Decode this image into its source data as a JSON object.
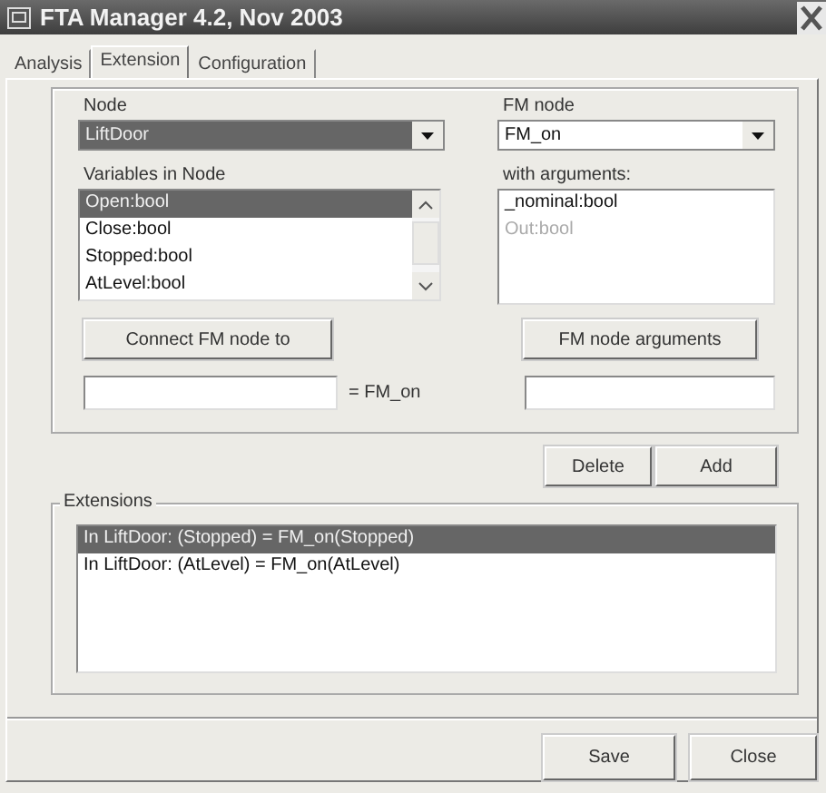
{
  "window": {
    "title": "FTA Manager 4.2, Nov 2003"
  },
  "tabs": [
    {
      "label": "Analysis",
      "selected": false
    },
    {
      "label": "Extension",
      "selected": true
    },
    {
      "label": "Configuration",
      "selected": false
    }
  ],
  "node": {
    "label": "Node",
    "value": "LiftDoor",
    "focused": true
  },
  "fm_node": {
    "label": "FM node",
    "value": "FM_on",
    "focused": false
  },
  "variables": {
    "label": "Variables in Node",
    "items": [
      {
        "text": "Open:bool",
        "selected": true
      },
      {
        "text": "Close:bool",
        "selected": false
      },
      {
        "text": "Stopped:bool",
        "selected": false
      },
      {
        "text": "AtLevel:bool",
        "selected": false
      }
    ]
  },
  "arguments": {
    "label": "with arguments:",
    "items": [
      {
        "text": "_nominal:bool",
        "disabled": false
      },
      {
        "text": "Out:bool",
        "disabled": true
      }
    ]
  },
  "connect_button": "Connect FM node to",
  "arguments_button": "FM node arguments",
  "connect_suffix": "= FM_on",
  "edit_buttons": [
    "Delete",
    "Add"
  ],
  "extensions": {
    "label": "Extensions",
    "items": [
      {
        "text": "In LiftDoor: (Stopped) = FM_on(Stopped)",
        "selected": true
      },
      {
        "text": "In LiftDoor: (AtLevel) = FM_on(AtLevel)",
        "selected": false
      }
    ]
  },
  "footer_buttons": [
    "Save",
    "Close"
  ]
}
